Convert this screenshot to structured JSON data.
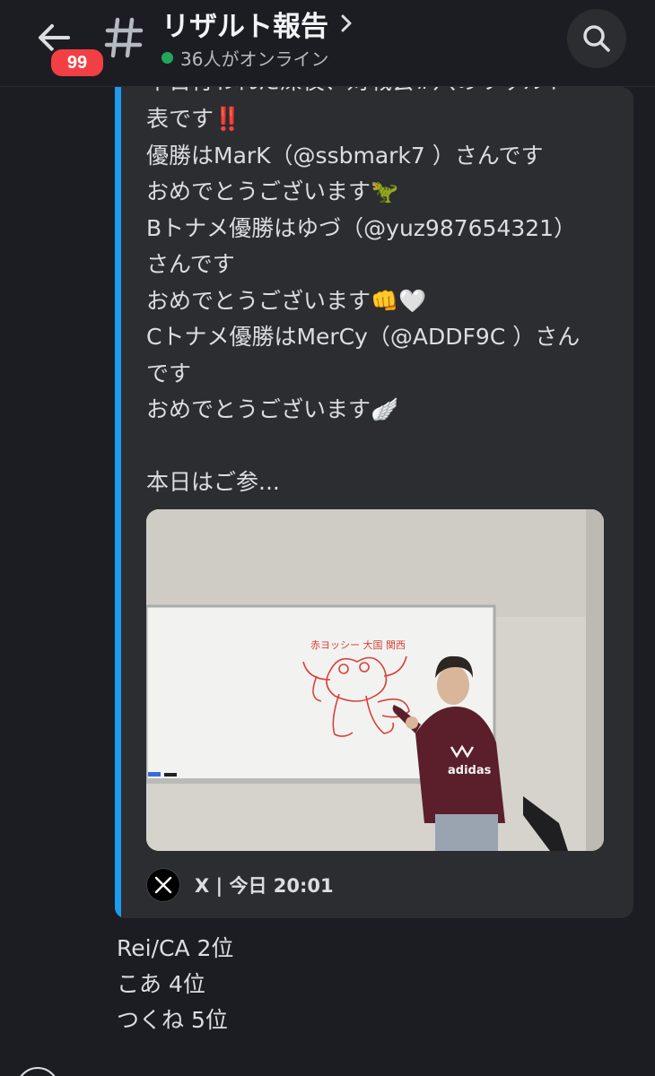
{
  "header": {
    "badge_count": "99",
    "channel_name": "リザルト報告",
    "online_status": "36人がオンライン",
    "icons": [
      "back-arrow-icon",
      "hash-icon",
      "chevron-right-icon",
      "search-icon"
    ]
  },
  "embed": {
    "partial_top_line": "本日行われた深夜、対戦会#八のリザルト",
    "lines": [
      "表です‼️",
      "優勝はMarK（@ssbmark7 ）さんです",
      "おめでとうございます🦖",
      "Bトナメ優勝はゆづ（@yuz987654321）",
      "さんです",
      "おめでとうございます👊🤍",
      "Cトナメ優勝はMerCy（@ADDF9C ）さん",
      "です",
      "おめでとうございます🪽",
      "",
      "本日はご参..."
    ],
    "image": {
      "whiteboard_caption": "赤ヨッシー 大国 関西",
      "hoodie_text": "adidas"
    },
    "footer": {
      "source": "X | 今日 20:01"
    },
    "accent_color": "#1d9bf0"
  },
  "message": {
    "lines": [
      "Rei/CA 2位",
      "こあ 4位",
      "つくね 5位"
    ]
  },
  "colors": {
    "background": "#1c1d22",
    "embed_bg": "#2b2d31",
    "badge": "#f23f43",
    "online": "#23a55a"
  }
}
